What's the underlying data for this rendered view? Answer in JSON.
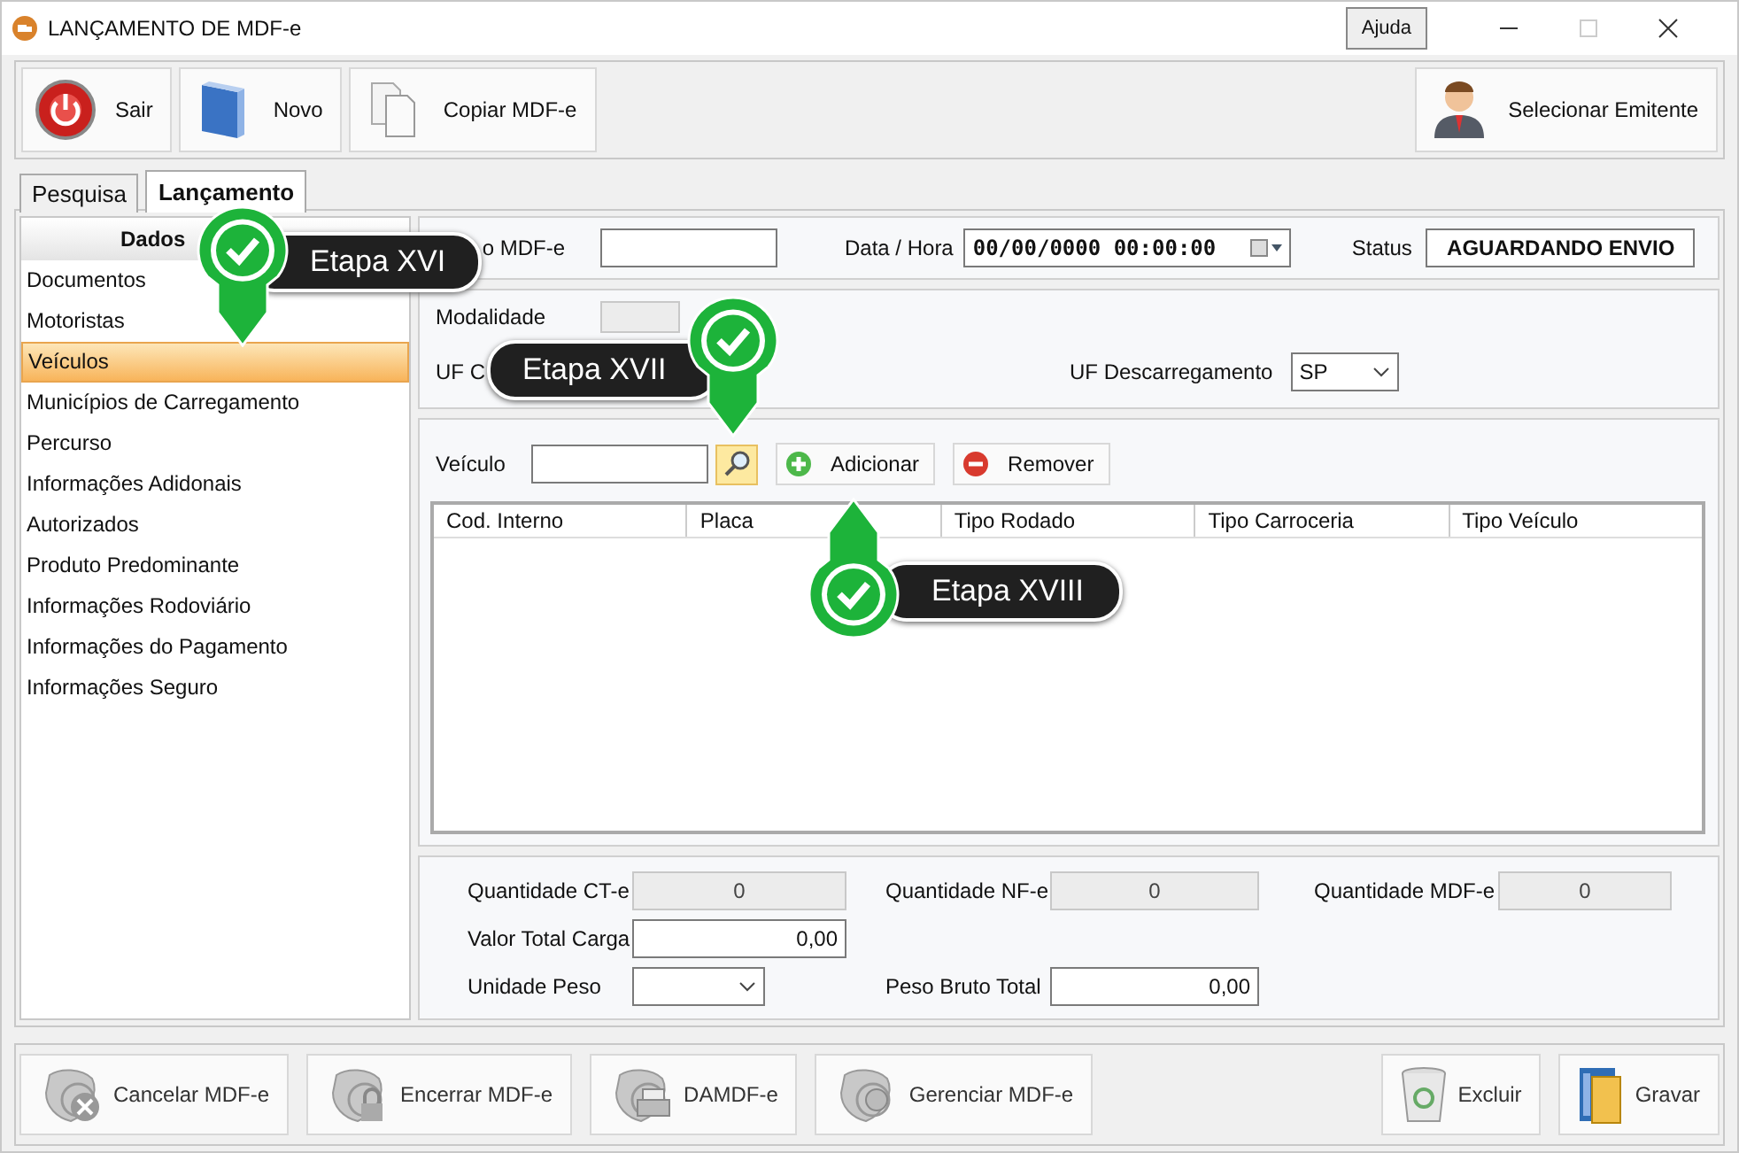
{
  "window": {
    "title": "LANÇAMENTO DE MDF-e",
    "help_button": "Ajuda"
  },
  "toolbar": {
    "left": [
      {
        "label": "Sair",
        "kind": "power"
      },
      {
        "label": "Novo",
        "kind": "book"
      },
      {
        "label": "Copiar MDF-e",
        "kind": "copy"
      }
    ],
    "right": [
      {
        "label": "Selecionar Emitente",
        "kind": "person"
      }
    ]
  },
  "tabs": [
    {
      "label": "Pesquisa",
      "selected": false
    },
    {
      "label": "Lançamento",
      "selected": true
    }
  ],
  "sidebar": {
    "title": "Dados",
    "items": [
      {
        "label": "Documentos",
        "selected": false
      },
      {
        "label": "Motoristas",
        "selected": false
      },
      {
        "label": "Veículos",
        "selected": true
      },
      {
        "label": "Municípios de Carregamento",
        "selected": false
      },
      {
        "label": "Percurso",
        "selected": false
      },
      {
        "label": "Informações Adidonais",
        "selected": false
      },
      {
        "label": "Autorizados",
        "selected": false
      },
      {
        "label": "Produto Predominante",
        "selected": false
      },
      {
        "label": "Informações Rodoviário",
        "selected": false
      },
      {
        "label": "Informações do Pagamento",
        "selected": false
      },
      {
        "label": "Informações Seguro",
        "selected": false
      }
    ]
  },
  "header": {
    "number_label": "o MDF-e",
    "date_label": "Data / Hora",
    "date_value": "00/00/0000 00:00:00",
    "status_label": "Status",
    "status_value": "AGUARDANDO ENVIO"
  },
  "transport": {
    "modality_label": "Modalidade",
    "loading_label": "UF C",
    "unloading_label": "UF Descarregamento",
    "unloading_value": "SP"
  },
  "vehicles": {
    "label": "Veículo",
    "add_button": "Adicionar",
    "remove_button": "Remover",
    "columns": [
      "Cod. Interno",
      "Placa",
      "Tipo Rodado",
      "Tipo Carroceria",
      "Tipo Veículo"
    ]
  },
  "totals": [
    [
      {
        "label": "Quantidade CT-e",
        "value": "0",
        "kind": "readonly"
      },
      {
        "label": "Quantidade NF-e",
        "value": "0",
        "kind": "readonly"
      },
      {
        "label": "Quantidade MDF-e",
        "value": "0",
        "kind": "readonly"
      }
    ],
    [
      {
        "label": "Valor Total Carga",
        "value": "0,00",
        "kind": "input"
      }
    ],
    [
      {
        "label": "Unidade Peso",
        "kind": "select"
      },
      {
        "label": "Peso Bruto Total",
        "value": "0,00",
        "kind": "input"
      }
    ]
  ],
  "bottom_toolbar": {
    "left": [
      {
        "label": "Cancelar MDF-e",
        "kind": "cancel"
      },
      {
        "label": "Encerrar MDF-e",
        "kind": "lock"
      },
      {
        "label": "DAMDF-e",
        "kind": "print"
      },
      {
        "label": "Gerenciar MDF-e",
        "kind": "manage"
      }
    ],
    "right": [
      {
        "label": "Excluir",
        "kind": "trash"
      },
      {
        "label": "Gravar",
        "kind": "save"
      }
    ]
  },
  "callouts": [
    {
      "label": "Etapa XVI"
    },
    {
      "label": "Etapa XVII"
    },
    {
      "label": "Etapa XVIII"
    }
  ]
}
